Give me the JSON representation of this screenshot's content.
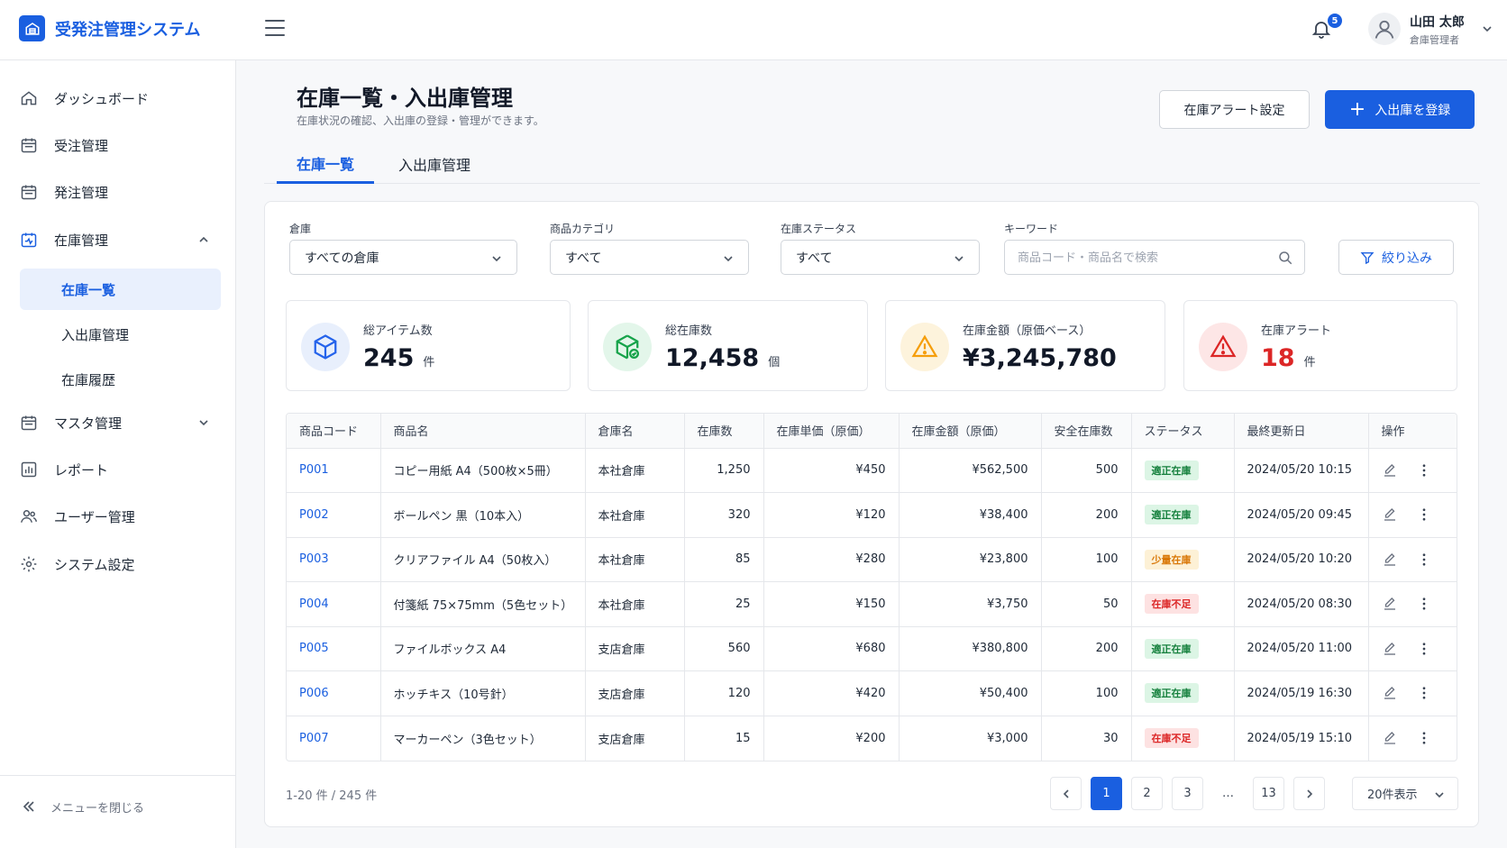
{
  "header": {
    "app_title": "受発注管理システム",
    "notification_count": "5",
    "user_name": "山田 太郎",
    "user_role": "倉庫管理者"
  },
  "sidebar": {
    "items": [
      {
        "label": "ダッシュボード",
        "icon": "home-icon"
      },
      {
        "label": "受注管理",
        "icon": "calendar-icon"
      },
      {
        "label": "発注管理",
        "icon": "calendar-icon"
      },
      {
        "label": "在庫管理",
        "icon": "inventory-icon",
        "expanded": true
      },
      {
        "label": "マスタ管理",
        "icon": "calendar-icon",
        "expanded": false
      },
      {
        "label": "レポート",
        "icon": "chart-icon"
      },
      {
        "label": "ユーザー管理",
        "icon": "users-icon"
      },
      {
        "label": "システム設定",
        "icon": "gear-icon"
      }
    ],
    "sub_items": [
      {
        "label": "在庫一覧",
        "active": true
      },
      {
        "label": "入出庫管理",
        "active": false
      },
      {
        "label": "在庫履歴",
        "active": false
      }
    ],
    "collapse_label": "メニューを閉じる"
  },
  "page": {
    "title": "在庫一覧・入出庫管理",
    "subtitle": "在庫状況の確認、入出庫の登録・管理ができます。",
    "alert_settings_label": "在庫アラート設定",
    "register_label": "入出庫を登録"
  },
  "tabs": [
    {
      "label": "在庫一覧",
      "active": true
    },
    {
      "label": "入出庫管理",
      "active": false
    }
  ],
  "filters": {
    "warehouse": {
      "label": "倉庫",
      "value": "すべての倉庫"
    },
    "category": {
      "label": "商品カテゴリ",
      "value": "すべて"
    },
    "status": {
      "label": "在庫ステータス",
      "value": "すべて"
    },
    "keyword": {
      "label": "キーワード",
      "placeholder": "商品コード・商品名で検索",
      "value": ""
    },
    "filter_button": "絞り込み"
  },
  "summary": [
    {
      "label": "総アイテム数",
      "value": "245",
      "unit": "件",
      "icon": "box-icon",
      "color": "#2563eb"
    },
    {
      "label": "総在庫数",
      "value": "12,458",
      "unit": "個",
      "icon": "package-check-icon",
      "color": "#16a34a"
    },
    {
      "label": "在庫金額（原価ベース）",
      "value": "¥3,245,780",
      "unit": "",
      "icon": "warning-icon",
      "color": "#f59e0b"
    },
    {
      "label": "在庫アラート",
      "value": "18",
      "unit": "件",
      "icon": "alert-icon",
      "color": "#dc2626"
    }
  ],
  "table": {
    "headers": [
      "商品コード",
      "商品名",
      "倉庫名",
      "在庫数",
      "在庫単価（原価）",
      "在庫金額（原価）",
      "安全在庫数",
      "ステータス",
      "最終更新日",
      "操作"
    ],
    "rows": [
      {
        "code": "P001",
        "name": "コピー用紙 A4（500枚×5冊）",
        "warehouse": "本社倉庫",
        "qty": "1,250",
        "unit_price": "¥450",
        "amount": "¥562,500",
        "safety": "500",
        "status": "適正在庫",
        "status_type": "ok",
        "updated": "2024/05/20 10:15"
      },
      {
        "code": "P002",
        "name": "ボールペン 黒（10本入）",
        "warehouse": "本社倉庫",
        "qty": "320",
        "unit_price": "¥120",
        "amount": "¥38,400",
        "safety": "200",
        "status": "適正在庫",
        "status_type": "ok",
        "updated": "2024/05/20 09:45"
      },
      {
        "code": "P003",
        "name": "クリアファイル A4（50枚入）",
        "warehouse": "本社倉庫",
        "qty": "85",
        "unit_price": "¥280",
        "amount": "¥23,800",
        "safety": "100",
        "status": "少量在庫",
        "status_type": "low",
        "updated": "2024/05/20 10:20"
      },
      {
        "code": "P004",
        "name": "付箋紙 75×75mm（5色セット）",
        "warehouse": "本社倉庫",
        "qty": "25",
        "unit_price": "¥150",
        "amount": "¥3,750",
        "safety": "50",
        "status": "在庫不足",
        "status_type": "short",
        "updated": "2024/05/20 08:30"
      },
      {
        "code": "P005",
        "name": "ファイルボックス A4",
        "warehouse": "支店倉庫",
        "qty": "560",
        "unit_price": "¥680",
        "amount": "¥380,800",
        "safety": "200",
        "status": "適正在庫",
        "status_type": "ok",
        "updated": "2024/05/20 11:00"
      },
      {
        "code": "P006",
        "name": "ホッチキス（10号針）",
        "warehouse": "支店倉庫",
        "qty": "120",
        "unit_price": "¥420",
        "amount": "¥50,400",
        "safety": "100",
        "status": "適正在庫",
        "status_type": "ok",
        "updated": "2024/05/19 16:30"
      },
      {
        "code": "P007",
        "name": "マーカーペン（3色セット）",
        "warehouse": "支店倉庫",
        "qty": "15",
        "unit_price": "¥200",
        "amount": "¥3,000",
        "safety": "30",
        "status": "在庫不足",
        "status_type": "short",
        "updated": "2024/05/19 15:10"
      }
    ]
  },
  "pagination": {
    "info": "1-20 件 / 245 件",
    "pages": [
      "1",
      "2",
      "3",
      "…",
      "13"
    ],
    "current": "1",
    "per_page": "20件表示"
  }
}
